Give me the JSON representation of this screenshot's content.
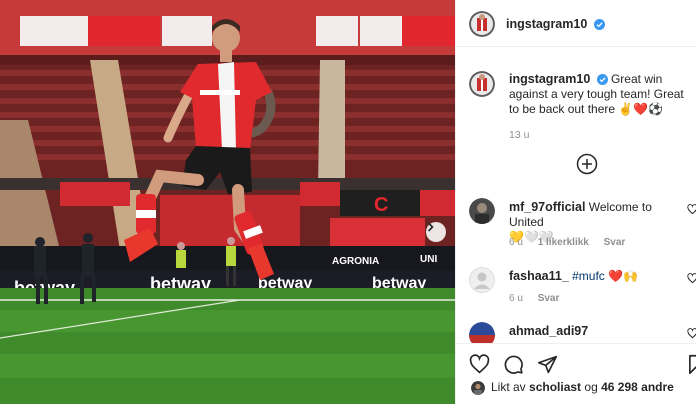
{
  "post": {
    "username": "ingstagram10",
    "caption_text": "Great win against a very tough team! Great to be back out there",
    "caption_emojis": "✌️❤️⚽",
    "time": "13 u"
  },
  "comments": [
    {
      "username": "mf_97official",
      "text": "Welcome to United",
      "emojis": "💛🤍🤍",
      "time": "6 u",
      "likes": "1 likerklikk",
      "reply": "Svar"
    },
    {
      "username": "fashaa11_",
      "text": "#mufc",
      "emojis": "❤️🙌",
      "time": "6 u",
      "reply": "Svar"
    },
    {
      "username": "ahmad_adi97"
    }
  ],
  "likes": {
    "prefix": "Likt av",
    "user": "scholiast",
    "middle": "og",
    "count": "46 298 andre"
  },
  "photo_banners": {
    "ad_left": "betway",
    "ad_mid": "betway",
    "ad_right": "betway",
    "ad_agronia": "AGRONIA",
    "stand_letter": "C",
    "unit": "UNI"
  },
  "icons": {
    "verified": "verified-badge-icon",
    "plus": "plus-circle-icon",
    "heart": "heart-icon",
    "comment": "comment-icon",
    "share": "paper-plane-icon",
    "save": "bookmark-icon",
    "next": "chevron-right-icon"
  },
  "colors": {
    "verified": "#3897f0",
    "text": "#262626",
    "muted": "#8e8e8e",
    "pitch": "#3f8a2a"
  }
}
